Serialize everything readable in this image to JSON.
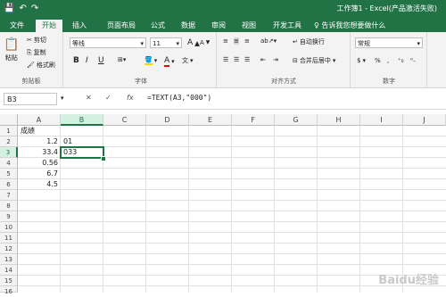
{
  "window": {
    "title": "工作簿1 - Excel(产品激活失败)"
  },
  "quick_access": {
    "save_icon": "save-icon",
    "undo_icon": "undo-icon",
    "redo_icon": "redo-icon"
  },
  "tabs": [
    {
      "label": "文件"
    },
    {
      "label": "开始"
    },
    {
      "label": "插入"
    },
    {
      "label": "页面布局"
    },
    {
      "label": "公式"
    },
    {
      "label": "数据"
    },
    {
      "label": "审阅"
    },
    {
      "label": "视图"
    },
    {
      "label": "开发工具"
    }
  ],
  "tell_me": {
    "text": "告诉我您想要做什么"
  },
  "ribbon": {
    "clipboard": {
      "paste": "粘贴",
      "cut": "剪切",
      "copy": "复制",
      "format_painter": "格式刷",
      "label": "剪贴板"
    },
    "font": {
      "font_name": "等线",
      "font_size": "11",
      "bold": "B",
      "italic": "I",
      "underline": "U",
      "grow": "A",
      "shrink": "A",
      "font_color_glyph": "A",
      "wen": "文",
      "label": "字体"
    },
    "alignment": {
      "wrap": "自动换行",
      "merge": "合并后居中",
      "label": "对齐方式"
    },
    "number": {
      "format": "常规",
      "currency": "$",
      "percent": "%",
      "comma": ",",
      "label": "数字"
    }
  },
  "formula_bar": {
    "name_box": "B3",
    "cancel": "✕",
    "enter": "✓",
    "fx": "fx",
    "formula": "=TEXT(A3,\"000\")"
  },
  "columns": [
    "A",
    "B",
    "C",
    "D",
    "E",
    "F",
    "G",
    "H",
    "I",
    "J"
  ],
  "rows": [
    "1",
    "2",
    "3",
    "4",
    "5",
    "6",
    "7",
    "8",
    "9",
    "10",
    "11",
    "12",
    "13",
    "14",
    "15",
    "16"
  ],
  "cells": {
    "A1": "成绩",
    "A2": "1.2",
    "B2": "01",
    "A3": "33.4",
    "B3": "033",
    "A4": "0.56",
    "A5": "6.7",
    "A6": "4.5"
  },
  "watermark": "Baidu经验"
}
